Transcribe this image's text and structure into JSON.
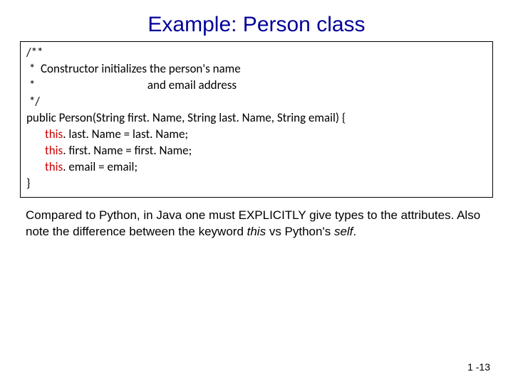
{
  "title": "Example: Person class",
  "code": {
    "l1": "/**",
    "l2": " *  Constructor initializes the person's name",
    "l3": " *                                         and email address",
    "l4": " */",
    "l5_a": "public",
    "l5_b": " Person(String first. Name, String last. Name, String email) {",
    "l6_a": "this",
    "l6_b": ". last. Name = last. Name;",
    "l7_a": "this",
    "l7_b": ". first. Name = first. Name;",
    "l8_a": "this",
    "l8_b": ". email = email;",
    "l9": "}"
  },
  "paragraph": {
    "p1": "Compared to Python, in Java one must EXPLICITLY give types to the attributes. Also note the difference between the keyword ",
    "this": "this",
    "p2": " vs Python's ",
    "self": "self",
    "p3": "."
  },
  "pageNumber": "1 -13"
}
